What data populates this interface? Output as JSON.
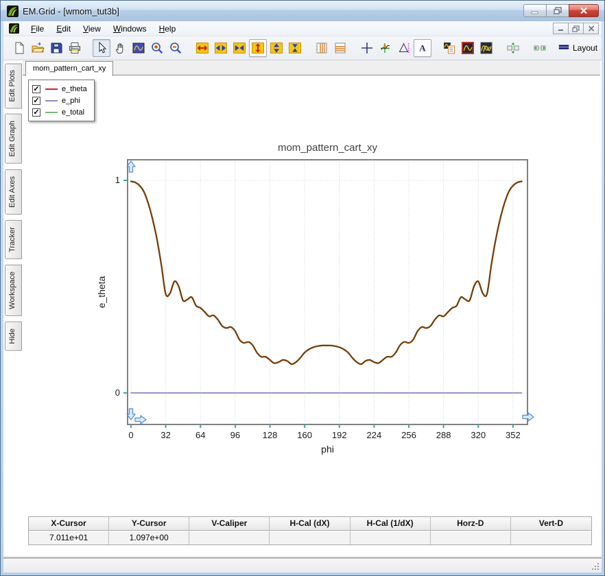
{
  "window": {
    "title": "EM.Grid - [wmom_tut3b]",
    "controls": [
      "minimize",
      "restore",
      "close"
    ]
  },
  "menu": {
    "items": [
      {
        "label": "File"
      },
      {
        "label": "Edit"
      },
      {
        "label": "View"
      },
      {
        "label": "Windows"
      },
      {
        "label": "Help"
      }
    ],
    "mdi_controls": [
      "minimize",
      "restore",
      "close"
    ]
  },
  "toolbar": {
    "layout_label": "Layout",
    "buttons": [
      {
        "name": "new-document-button",
        "icon": "new-document-icon"
      },
      {
        "name": "open-file-button",
        "icon": "open-folder-icon"
      },
      {
        "name": "save-button",
        "icon": "save-icon"
      },
      {
        "name": "print-button",
        "icon": "print-icon"
      },
      {
        "sep": true
      },
      {
        "name": "select-tool-button",
        "icon": "select-cursor-icon",
        "state": "pressed"
      },
      {
        "name": "pan-tool-button",
        "icon": "pan-hand-icon"
      },
      {
        "name": "zoom-box-tool-button",
        "icon": "zoom-box-icon"
      },
      {
        "name": "zoom-in-button",
        "icon": "zoom-in-icon"
      },
      {
        "name": "zoom-out-button",
        "icon": "zoom-out-icon"
      },
      {
        "sep": true
      },
      {
        "name": "expand-x-button",
        "icon": "expand-x-icon"
      },
      {
        "name": "widen-x-button",
        "icon": "widen-x-icon"
      },
      {
        "name": "shrink-x-button",
        "icon": "shrink-x-icon"
      },
      {
        "name": "expand-y-button",
        "icon": "expand-y-icon",
        "state": "framed"
      },
      {
        "name": "widen-y-button",
        "icon": "widen-y-icon"
      },
      {
        "name": "shrink-y-button",
        "icon": "shrink-y-icon"
      },
      {
        "sep": true
      },
      {
        "name": "vertical-gridlines-button",
        "icon": "vertical-gridlines-icon"
      },
      {
        "name": "horizontal-gridlines-button",
        "icon": "horizontal-gridlines-icon"
      },
      {
        "sep": true
      },
      {
        "name": "crosshair-button",
        "icon": "crosshair-icon"
      },
      {
        "name": "tracker-tool-button",
        "icon": "tracker-icon"
      },
      {
        "name": "caliper-tool-button",
        "icon": "caliper-icon"
      },
      {
        "name": "text-label-button",
        "icon": "text-a-icon",
        "state": "framed"
      },
      {
        "sep": true
      },
      {
        "name": "plot-properties-button",
        "icon": "plot-list-icon"
      },
      {
        "name": "single-graph-button",
        "icon": "single-graph-icon"
      },
      {
        "name": "multi-graph-button",
        "icon": "multi-graph-icon"
      },
      {
        "sep": true
      },
      {
        "name": "fit-vertical-button",
        "icon": "fit-vertical-icon"
      },
      {
        "sep": true
      },
      {
        "name": "fit-horizontal-button",
        "icon": "fit-horizontal-icon"
      },
      {
        "sep": true
      },
      {
        "name": "layout-button",
        "icon": "layout-icon"
      }
    ]
  },
  "side_tabs": [
    {
      "label": "Edit Plots"
    },
    {
      "label": "Edit Graph"
    },
    {
      "label": "Edit Axes"
    },
    {
      "label": "Tracker"
    },
    {
      "label": "Workspace"
    },
    {
      "label": "Hide"
    }
  ],
  "document_tab": "mom_pattern_cart_xy",
  "legend": {
    "items": [
      {
        "label": "e_theta",
        "checked": true,
        "color": "#d42020"
      },
      {
        "label": "e_phi",
        "checked": true,
        "color": "#8888c8"
      },
      {
        "label": "e_total",
        "checked": true,
        "color": "#78b878"
      }
    ]
  },
  "chart_data": {
    "type": "line",
    "title": "mom_pattern_cart_xy",
    "xlabel": "phi",
    "ylabel": "e_theta",
    "xlim": [
      -4,
      366
    ],
    "ylim": [
      -0.123,
      1.106
    ],
    "xticks": [
      0,
      32,
      64,
      96,
      128,
      160,
      192,
      224,
      256,
      288,
      320,
      352
    ],
    "yticks": [
      0,
      1
    ],
    "grid": true,
    "grid_style": "dotted",
    "x": [
      0,
      4,
      8,
      12,
      16,
      20,
      24,
      28,
      32,
      36,
      40,
      44,
      48,
      52,
      56,
      60,
      64,
      68,
      72,
      76,
      80,
      84,
      88,
      92,
      96,
      100,
      104,
      108,
      112,
      116,
      120,
      124,
      128,
      132,
      136,
      140,
      144,
      148,
      152,
      156,
      160,
      164,
      168,
      172,
      176,
      180,
      184,
      188,
      192,
      196,
      200,
      204,
      208,
      212,
      216,
      220,
      224,
      228,
      232,
      236,
      240,
      244,
      248,
      252,
      256,
      260,
      264,
      268,
      272,
      276,
      280,
      284,
      288,
      292,
      296,
      300,
      304,
      308,
      312,
      316,
      320,
      324,
      328,
      332,
      336,
      340,
      344,
      348,
      352,
      356,
      360
    ],
    "series": [
      {
        "name": "e_total",
        "plot_color": "#5fa05f",
        "values_ref": "e_theta",
        "note": "overlaps e_theta exactly"
      },
      {
        "name": "e_phi",
        "plot_color": "#7272b8",
        "constant": 0
      },
      {
        "name": "e_theta",
        "plot_color": "#7b3c05",
        "values": [
          0.995,
          0.99,
          0.975,
          0.945,
          0.89,
          0.815,
          0.72,
          0.6,
          0.465,
          0.47,
          0.525,
          0.5,
          0.435,
          0.44,
          0.45,
          0.41,
          0.4,
          0.38,
          0.36,
          0.365,
          0.345,
          0.315,
          0.305,
          0.31,
          0.29,
          0.25,
          0.235,
          0.24,
          0.225,
          0.19,
          0.17,
          0.17,
          0.155,
          0.14,
          0.145,
          0.155,
          0.15,
          0.135,
          0.145,
          0.165,
          0.19,
          0.205,
          0.215,
          0.22,
          0.223,
          0.223,
          0.223,
          0.22,
          0.215,
          0.205,
          0.19,
          0.165,
          0.145,
          0.135,
          0.15,
          0.155,
          0.145,
          0.14,
          0.155,
          0.17,
          0.17,
          0.19,
          0.225,
          0.24,
          0.235,
          0.25,
          0.29,
          0.31,
          0.305,
          0.315,
          0.345,
          0.365,
          0.36,
          0.38,
          0.4,
          0.41,
          0.45,
          0.44,
          0.435,
          0.5,
          0.525,
          0.47,
          0.465,
          0.6,
          0.72,
          0.815,
          0.89,
          0.945,
          0.975,
          0.99,
          0.995
        ]
      }
    ],
    "colors": {
      "plot_border": "#808080",
      "gridline": "#d8dce8",
      "tick_mark": "#3aa6a6",
      "axis_handle": "#4d90e0",
      "title_text": "#404040",
      "label_text": "#1a1a1a"
    }
  },
  "tracker_table": {
    "headers": [
      "X-Cursor",
      "Y-Cursor",
      "V-Caliper",
      "H-Cal (dX)",
      "H-Cal (1/dX)",
      "Horz-D",
      "Vert-D"
    ],
    "values": [
      "7.011e+01",
      "1.097e+00",
      "",
      "",
      "",
      "",
      ""
    ]
  }
}
